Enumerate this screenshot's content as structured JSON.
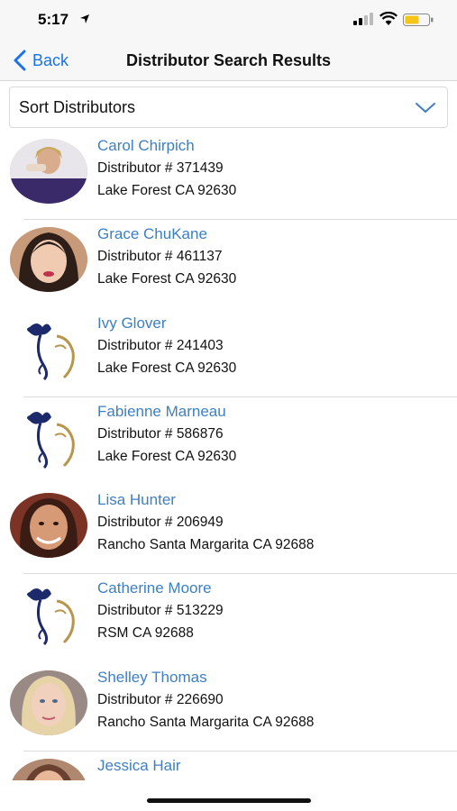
{
  "status_bar": {
    "time": "5:17",
    "icons": [
      "location-arrow-icon",
      "cellular-signal-icon",
      "wifi-icon",
      "battery-icon"
    ],
    "battery_color": "#f5c518"
  },
  "nav": {
    "back_label": "Back",
    "title": "Distributor Search Results",
    "accent_color": "#1a73e8"
  },
  "sort": {
    "label": "Sort Distributors",
    "chevron_icon": "chevron-down-icon"
  },
  "results": [
    {
      "name": "Carol Chirpich",
      "distributor": "Distributor # 371439",
      "location": "Lake Forest CA 92630",
      "avatar": "photo"
    },
    {
      "name": "Grace ChuKane",
      "distributor": "Distributor # 461137",
      "location": "Lake Forest CA 92630",
      "avatar": "photo"
    },
    {
      "name": "Ivy Glover",
      "distributor": "Distributor # 241403",
      "location": "Lake Forest CA 92630",
      "avatar": "logo"
    },
    {
      "name": "Fabienne Marneau",
      "distributor": "Distributor # 586876",
      "location": "Lake Forest CA 92630",
      "avatar": "logo"
    },
    {
      "name": "Lisa Hunter",
      "distributor": "Distributor # 206949",
      "location": "Rancho Santa Margarita CA 92688",
      "avatar": "photo"
    },
    {
      "name": "Catherine Moore",
      "distributor": "Distributor # 513229",
      "location": "RSM CA 92688",
      "avatar": "logo"
    },
    {
      "name": "Shelley Thomas",
      "distributor": "Distributor # 226690",
      "location": "Rancho Santa Margarita CA 92688",
      "avatar": "photo"
    },
    {
      "name": "Jessica Hair",
      "distributor": "",
      "location": "",
      "avatar": "photo"
    }
  ],
  "colors": {
    "name_link": "#3e7fc1",
    "logo_navy": "#1c2a6b",
    "logo_gold": "#b8954a"
  }
}
